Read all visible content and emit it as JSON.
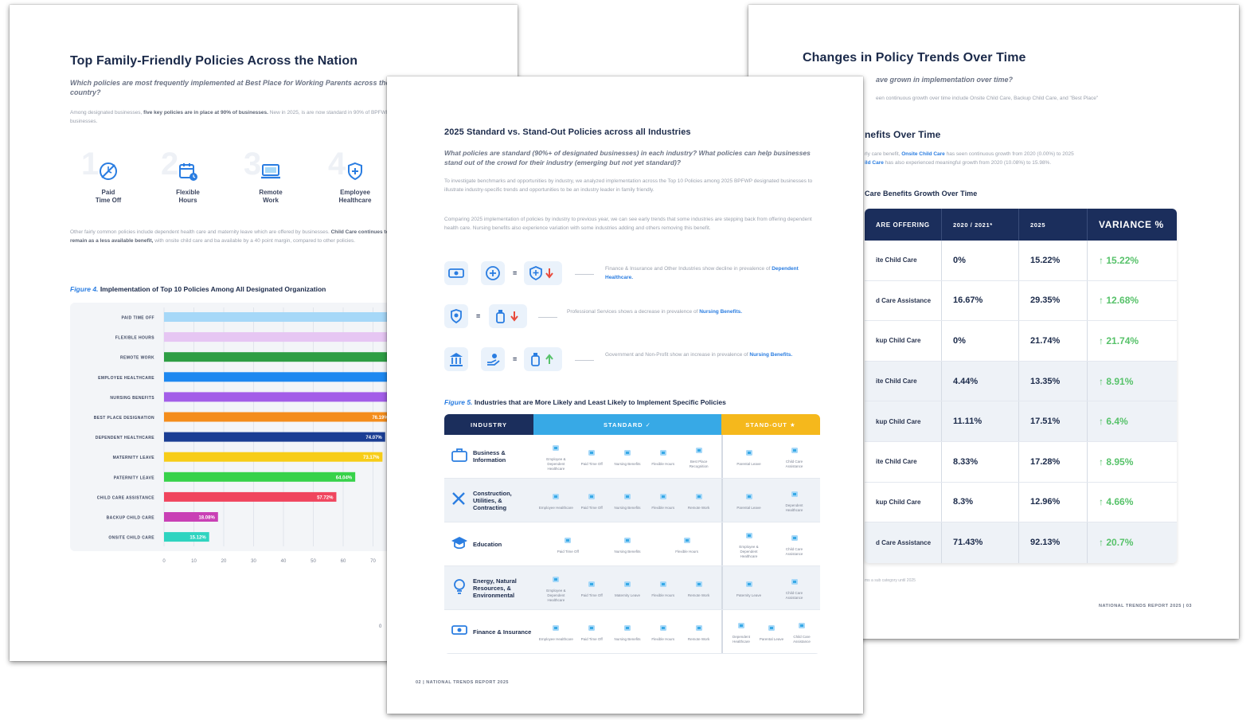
{
  "left_page": {
    "title": "Top Family-Friendly Policies Across the Nation",
    "subtitle": "Which policies are most frequently implemented at Best Place for Working Parents across the country?",
    "body1_prefix": "Among designated businesses,",
    "body1_bold": "five key policies are in place at 90% of businesses.",
    "body1_suffix": "New in 2025, is are now standard in 90% of BPFWP businesses.",
    "policy_icons": [
      {
        "num": "1",
        "label_line1": "Paid",
        "label_line2": "Time Off",
        "icon": "no-time-icon"
      },
      {
        "num": "2",
        "label_line1": "Flexible",
        "label_line2": "Hours",
        "icon": "calendar-clock-icon"
      },
      {
        "num": "3",
        "label_line1": "Remote",
        "label_line2": "Work",
        "icon": "laptop-icon"
      },
      {
        "num": "4",
        "label_line1": "Employee",
        "label_line2": "Healthcare",
        "icon": "shield-plus-icon"
      }
    ],
    "body2_prefix": "Other fairly common policies include dependent health care and maternity leave which are offered by businesses.",
    "body2_bold": "Child Care continues to remain as a less available benefit,",
    "body2_suffix": "with onsite child care and ba available by a 40 point margin, compared to other policies.",
    "figure_label": "Figure 4.",
    "figure_title": "Implementation of Top 10 Policies Among All Designated Organization",
    "page_marker": "0"
  },
  "chart_data": {
    "type": "bar",
    "orientation": "horizontal",
    "categories": [
      "PAID TIME OFF",
      "FLEXIBLE HOURS",
      "REMOTE WORK",
      "EMPLOYEE HEALTHCARE",
      "NURSING BENEFITS",
      "BEST PLACE DESIGNATION",
      "DEPENDENT HEALTHCARE",
      "MATERNITY LEAVE",
      "PATERNITY LEAVE",
      "CHILD CARE ASSISTANCE",
      "BACKUP CHILD CARE",
      "ONSITE CHILD CARE"
    ],
    "values": [
      100,
      100,
      100,
      100,
      100,
      76.19,
      74.07,
      73.17,
      64.04,
      57.72,
      18.08,
      15.12
    ],
    "value_labels": [
      "",
      "",
      "",
      "",
      "",
      "76.19%",
      "74.07%",
      "73.17%",
      "64.04%",
      "57.72%",
      "18.08%",
      "15.12%"
    ],
    "colors": [
      "#a6d8f8",
      "#e6c6f3",
      "#2e9e44",
      "#1e88f0",
      "#a35ee8",
      "#f48d1c",
      "#1b3e94",
      "#f7cd18",
      "#37d24a",
      "#f0455e",
      "#c940b5",
      "#2fd4c0"
    ],
    "x_ticks": [
      "0",
      "10",
      "20",
      "30",
      "40",
      "50",
      "60",
      "70"
    ],
    "xlim": [
      0,
      100
    ],
    "grid": true,
    "title": "Implementation of Top 10 Policies Among All Designated Organization"
  },
  "center_page": {
    "title": "2025 Standard vs. Stand-Out Policies across all Industries",
    "subtitle": "What policies are standard (90%+ of designated businesses) in each industry? What policies can help businesses stand out of the crowd for their industry (emerging but not yet standard)?",
    "body1": "To investigate benchmarks and opportunities by industry, we analyzed implementation across the Top 10 Policies among 2025 BPFWP designated businesses to illustrate industry-specific trends and opportunities to be an industry leader in family friendly.",
    "body2": "Comparing 2025 implementation of policies by industry to previous year, we can see early trends that some industries are stepping back from offering dependent health care. Nursing benefits also experience variation with some industries adding and others removing this benefit.",
    "insights": [
      {
        "desc": "Finance & Insurance and Other Industries show decline in prevalence of",
        "highlight": "Dependent Healthcare."
      },
      {
        "desc": "Professional Services shows a decrease in prevalence of",
        "highlight": "Nursing Benefits."
      },
      {
        "desc": "Government and Non-Profit show an increase in prevalence of",
        "highlight": "Nursing Benefits."
      }
    ],
    "figure_label": "Figure 5.",
    "figure_title": "Industries that are More Likely and Least Likely to Implement Specific Policies",
    "table_headers": {
      "industry": "INDUSTRY",
      "standard": "STANDARD",
      "standout": "STAND-OUT"
    },
    "rows": [
      {
        "industry": "Business & Information",
        "standard": [
          "Employee & Dependent Healthcare",
          "Paid Time Off",
          "Nursing Benefits",
          "Flexible Hours",
          "Best Place Recognition"
        ],
        "standout": [
          "Parental Leave",
          "Child Care Assistance"
        ]
      },
      {
        "industry": "Construction, Utilities, & Contracting",
        "standard": [
          "Employee Healthcare",
          "Paid Time Off",
          "Nursing Benefits",
          "Flexible Hours",
          "Remote Work"
        ],
        "standout": [
          "Parental Leave",
          "Dependent Healthcare"
        ]
      },
      {
        "industry": "Education",
        "standard": [
          "Paid Time Off",
          "Nursing Benefits",
          "Flexible Hours"
        ],
        "standout": [
          "Employee & Dependent Healthcare",
          "Child Care Assistance"
        ]
      },
      {
        "industry": "Energy, Natural Resources, & Environmental",
        "standard": [
          "Employee & Dependent Healthcare",
          "Paid Time Off",
          "Maternity Leave",
          "Flexible Hours",
          "Remote Work"
        ],
        "standout": [
          "Paternity Leave",
          "Child Care Assistance"
        ]
      },
      {
        "industry": "Finance & Insurance",
        "standard": [
          "Employee Healthcare",
          "Paid Time Off",
          "Nursing Benefits",
          "Flexible Hours",
          "Remote Work"
        ],
        "standout": [
          "Dependent Healthcare",
          "Parental Leave",
          "Child Care Assistance"
        ]
      }
    ],
    "footer": "02  |  NATIONAL TRENDS REPORT 2025"
  },
  "right_page": {
    "title": "Changes in Policy Trends Over Time",
    "subtitle": "ave grown in implementation over time?",
    "body1": "een continuous growth over time include Onsite Child Care, Backup Child Care, and \"Best Place\"",
    "section_title": "nefits Over Time",
    "body2_a": "rly care benefit,",
    "body2_hl1": "Onsite Child Care",
    "body2_b": "has seen continuous growth from 2020 (0.00%) to 2025",
    "body2_hl2": "ild Care",
    "body2_c": "has also experienced meaningful growth from 2020 (10.08%) to 15.98%.",
    "table_title": "Care Benefits Growth Over Time",
    "table_headers": [
      "ARE OFFERING",
      "2020 / 2021*",
      "2025",
      "VARIANCE %"
    ],
    "table_rows": [
      [
        "ite Child Care",
        "0%",
        "15.22%",
        "15.22%"
      ],
      [
        "d Care Assistance",
        "16.67%",
        "29.35%",
        "12.68%"
      ],
      [
        "kup Child Care",
        "0%",
        "21.74%",
        "21.74%"
      ],
      [
        "ite Child Care",
        "4.44%",
        "13.35%",
        "8.91%"
      ],
      [
        "kup Child Care",
        "11.11%",
        "17.51%",
        "6.4%"
      ],
      [
        "ite Child Care",
        "8.33%",
        "17.28%",
        "8.95%"
      ],
      [
        "kup Child Care",
        "8.3%",
        "12.96%",
        "4.66%"
      ],
      [
        "d Care Assistance",
        "71.43%",
        "92.13%",
        "20.7%"
      ]
    ],
    "note": "ms a sub category until 2025",
    "footer": "NATIONAL TRENDS REPORT 2025  |  03"
  },
  "colors": {
    "navy": "#1b2e5c",
    "standard_blue": "#37a9e6",
    "standout_yellow": "#f5b81c",
    "variance_green": "#57c26a",
    "link_blue": "#2a7de1",
    "decrease_red": "#e84b3c"
  }
}
